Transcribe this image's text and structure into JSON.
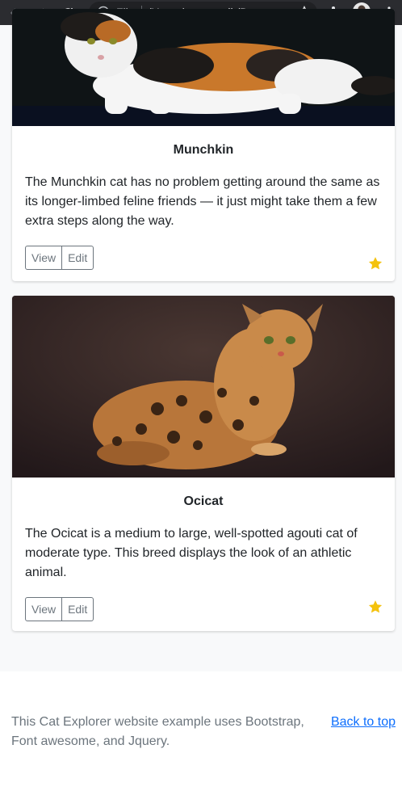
{
  "browser": {
    "url_label": "File",
    "url_text": "/Users/supersudh/Docu..."
  },
  "cards": [
    {
      "title": "Munchkin",
      "description": "The Munchkin cat has no problem getting around the same as its longer-limbed feline friends — it just might take them a few extra steps along the way.",
      "view_label": "View",
      "edit_label": "Edit",
      "image_name": "munchkin-cat-image"
    },
    {
      "title": "Ocicat",
      "description": "The Ocicat is a medium to large, well-spotted agouti cat of moderate type. This breed displays the look of an athletic animal.",
      "view_label": "View",
      "edit_label": "Edit",
      "image_name": "ocicat-image"
    }
  ],
  "footer": {
    "text": "This Cat Explorer website example uses Bootstrap, Font awesome, and Jquery.",
    "back_to_top": "Back to top"
  },
  "colors": {
    "star": "#f4c20d",
    "link": "#0d6efd",
    "chrome": "#2b2c30"
  }
}
